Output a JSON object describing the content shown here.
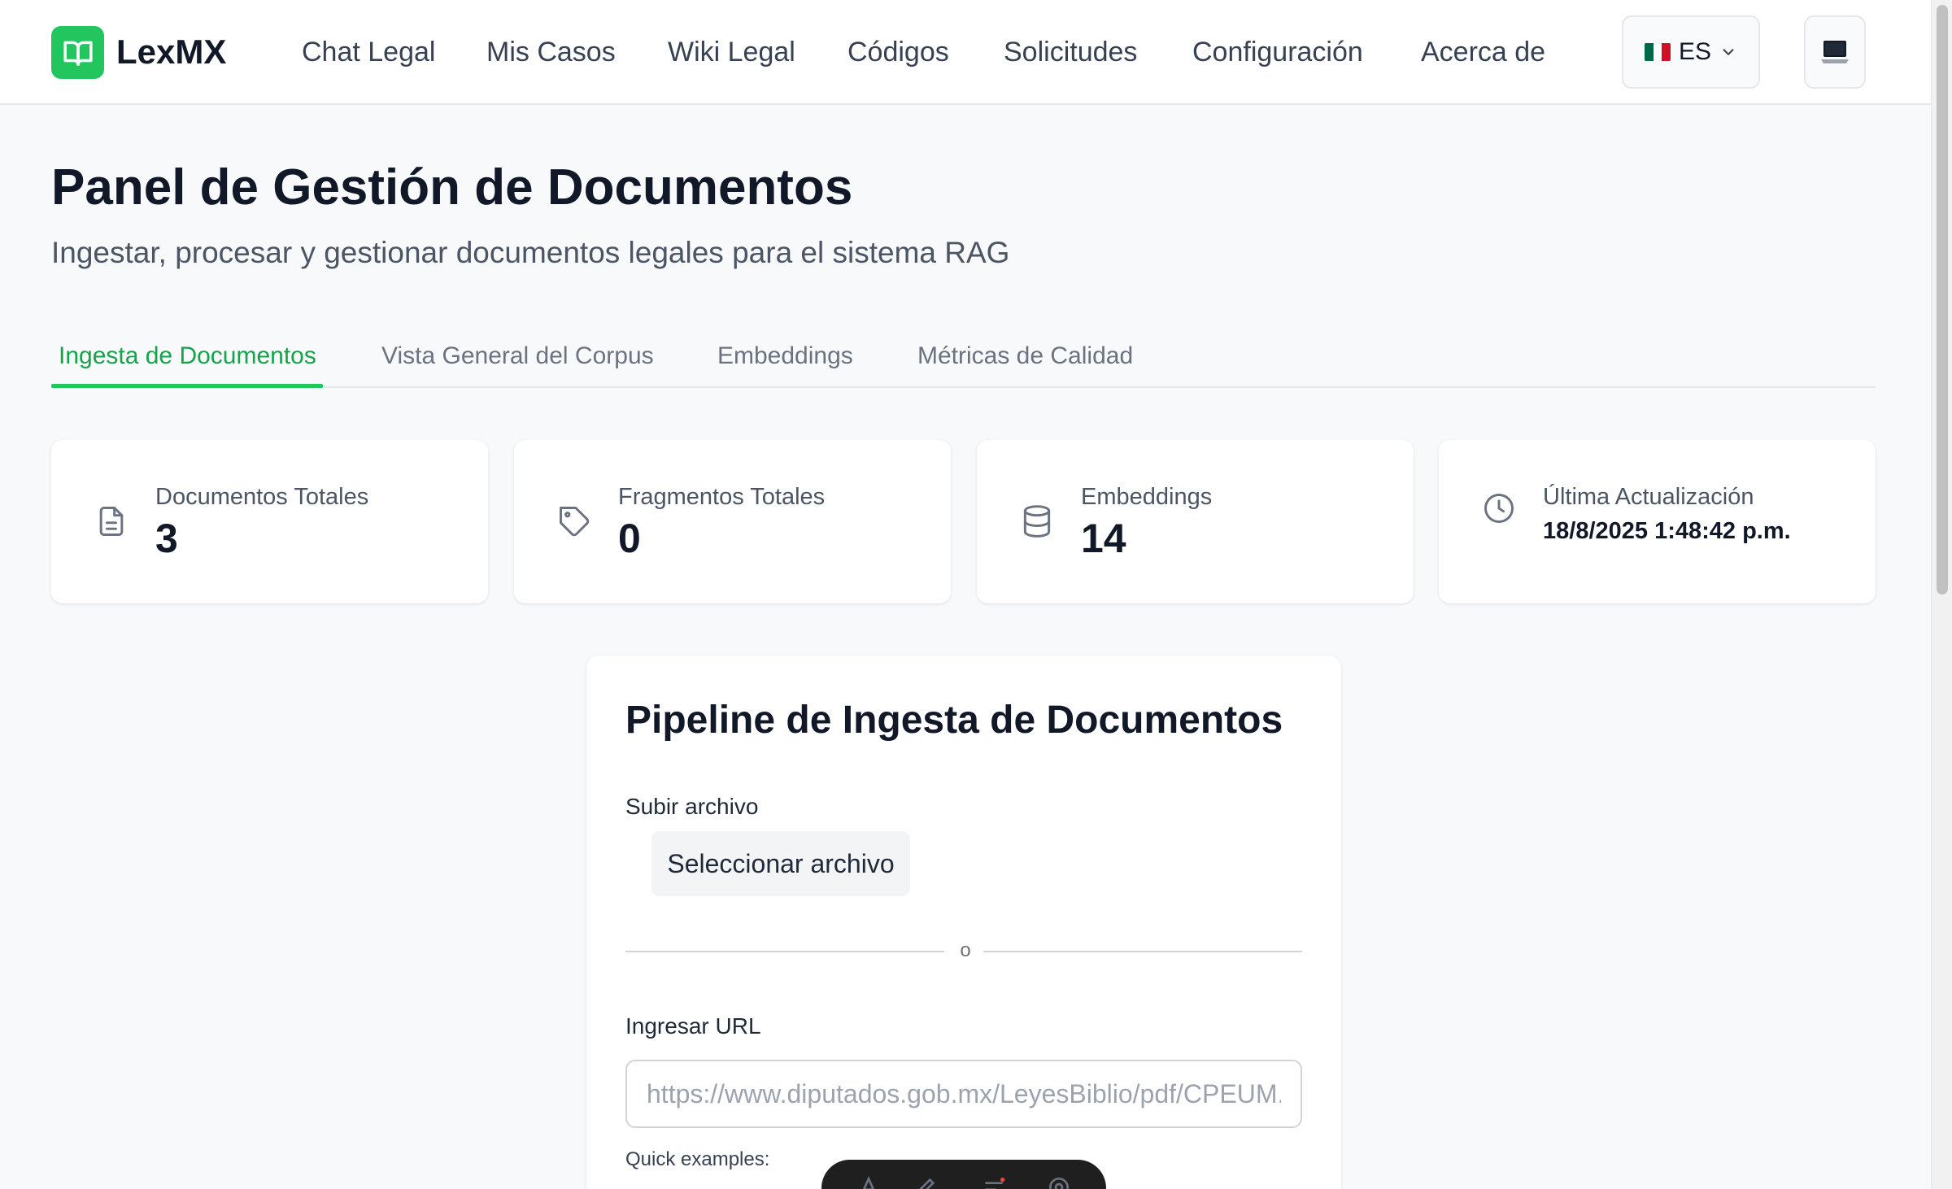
{
  "app": {
    "name": "LexMX"
  },
  "nav": {
    "items": [
      {
        "label": "Chat Legal"
      },
      {
        "label": "Mis Casos"
      },
      {
        "label": "Wiki Legal"
      },
      {
        "label": "Códigos"
      },
      {
        "label": "Solicitudes"
      },
      {
        "label": "Configuración"
      },
      {
        "label": "Acerca de"
      }
    ],
    "language": "ES",
    "flag_colors": [
      "#006847",
      "#ffffff",
      "#ce1126"
    ],
    "theme_icon": "laptop-icon"
  },
  "page": {
    "title": "Panel de Gestión de Documentos",
    "subtitle": "Ingestar, procesar y gestionar documentos legales para el sistema RAG"
  },
  "tabs": [
    {
      "label": "Ingesta de Documentos",
      "active": true
    },
    {
      "label": "Vista General del Corpus",
      "active": false
    },
    {
      "label": "Embeddings",
      "active": false
    },
    {
      "label": "Métricas de Calidad",
      "active": false
    }
  ],
  "stats": [
    {
      "label": "Documentos Totales",
      "value": "3",
      "icon": "document-icon"
    },
    {
      "label": "Fragmentos Totales",
      "value": "0",
      "icon": "tag-icon"
    },
    {
      "label": "Embeddings",
      "value": "14",
      "icon": "database-icon"
    },
    {
      "label": "Última Actualización",
      "value": "18/8/2025 1:48:42 p.m.",
      "icon": "clock-icon"
    }
  ],
  "pipeline": {
    "title": "Pipeline de Ingesta de Documentos",
    "upload_label": "Subir archivo",
    "select_file_button": "Seleccionar archivo",
    "divider_text": "o",
    "url_label": "Ingresar URL",
    "url_placeholder": "https://www.diputados.gob.mx/LeyesBiblio/pdf/CPEUM.pdf",
    "quick_examples_label": "Quick examples:"
  },
  "colors": {
    "accent": "#22c55e",
    "accent_text": "#16a34a"
  }
}
